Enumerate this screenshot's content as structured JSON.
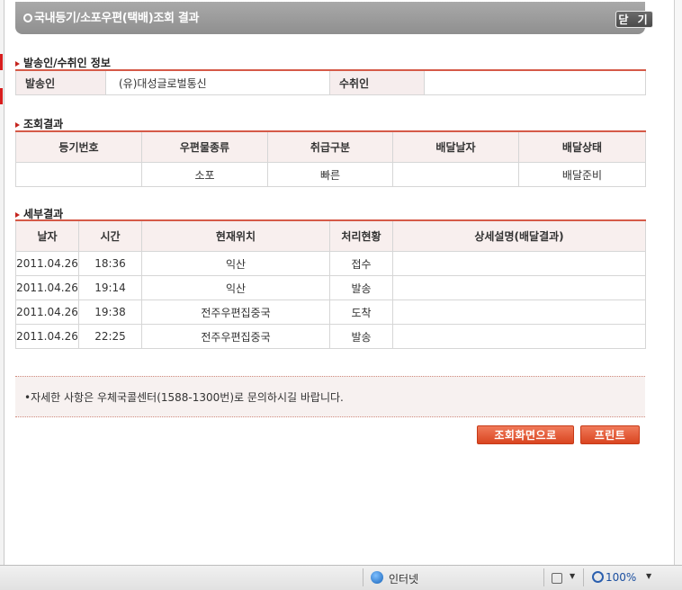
{
  "window": {
    "title": "국내등기/소포우편(택배)조회 결과",
    "close_label": "닫 기"
  },
  "sender_receiver": {
    "heading": "발송인/수취인 정보",
    "sender_label": "발송인",
    "sender_value": "(유)대성글로벌통신",
    "receiver_label": "수취인",
    "receiver_value": ""
  },
  "result": {
    "heading": "조회결과",
    "columns": [
      "등기번호",
      "우편물종류",
      "취급구분",
      "배달날자",
      "배달상태"
    ],
    "row": {
      "registration_number": "",
      "mail_type": "소포",
      "handling": "빠른",
      "delivery_date": "",
      "delivery_status": "배달준비"
    }
  },
  "detail": {
    "heading": "세부결과",
    "columns": [
      "날자",
      "시간",
      "현재위치",
      "처리현황",
      "상세설명(배달결과)"
    ],
    "rows": [
      {
        "date": "2011.04.26",
        "time": "18:36",
        "location": "익산",
        "status": "접수",
        "desc": ""
      },
      {
        "date": "2011.04.26",
        "time": "19:14",
        "location": "익산",
        "status": "발송",
        "desc": ""
      },
      {
        "date": "2011.04.26",
        "time": "19:38",
        "location": "전주우편집중국",
        "status": "도착",
        "desc": ""
      },
      {
        "date": "2011.04.26",
        "time": "22:25",
        "location": "전주우편집중국",
        "status": "발송",
        "desc": ""
      }
    ]
  },
  "notice": "•자세한 사항은 우체국콜센터(1588-1300번)로 문의하시길 바랍니다.",
  "buttons": {
    "back_label": "조회화면으로",
    "print_label": "프린트"
  },
  "statusbar": {
    "zone": "인터넷",
    "zoom": "100%"
  },
  "colors": {
    "accent": "#d94520",
    "header_bg": "#f8efee",
    "titlebar": "#999999"
  }
}
